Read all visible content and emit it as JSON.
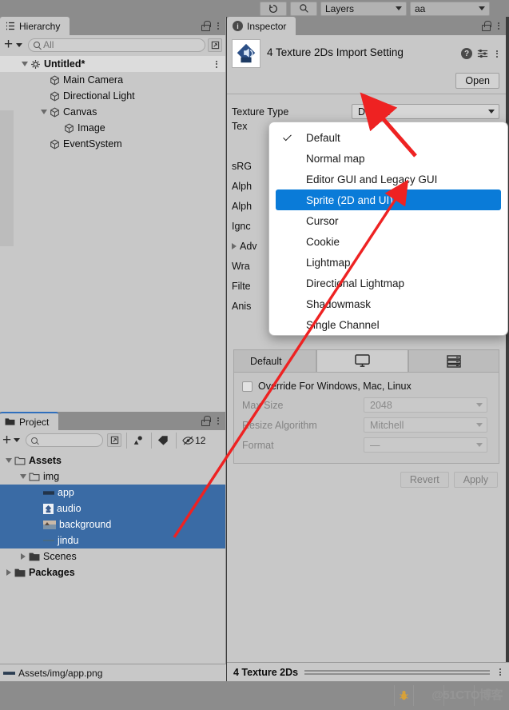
{
  "toolbar": {
    "history_icon": "history-icon",
    "search_icon": "search-icon",
    "layers_label": "Layers",
    "layout_label": "aa"
  },
  "hierarchy": {
    "tab_label": "Hierarchy",
    "create_label": "+",
    "search_value": "",
    "search_placeholder": "All",
    "scene_name": "Untitled*",
    "items": [
      {
        "label": "Main Camera",
        "depth": 2,
        "expandable": false
      },
      {
        "label": "Directional Light",
        "depth": 2,
        "expandable": false
      },
      {
        "label": "Canvas",
        "depth": 2,
        "expandable": true
      },
      {
        "label": "Image",
        "depth": 3,
        "expandable": false
      },
      {
        "label": "EventSystem",
        "depth": 2,
        "expandable": false
      }
    ]
  },
  "project": {
    "tab_label": "Project",
    "create_label": "+",
    "search_value": "",
    "search_placeholder": "",
    "hidden_count": "12",
    "items": [
      {
        "label": "Assets",
        "depth": 0,
        "type": "folder",
        "expanded": true,
        "selected": false,
        "bold": true
      },
      {
        "label": "img",
        "depth": 1,
        "type": "folder",
        "expanded": true,
        "selected": false,
        "bold": false
      },
      {
        "label": "app",
        "depth": 2,
        "type": "texture",
        "expanded": null,
        "selected": true,
        "bold": false
      },
      {
        "label": "audio",
        "depth": 2,
        "type": "texture",
        "expanded": null,
        "selected": true,
        "bold": false
      },
      {
        "label": "background",
        "depth": 2,
        "type": "texture",
        "expanded": null,
        "selected": true,
        "bold": false
      },
      {
        "label": "jindu",
        "depth": 2,
        "type": "texture",
        "expanded": null,
        "selected": true,
        "bold": false
      },
      {
        "label": "Scenes",
        "depth": 1,
        "type": "folder",
        "expanded": false,
        "selected": false,
        "bold": false
      },
      {
        "label": "Packages",
        "depth": 0,
        "type": "folder",
        "expanded": false,
        "selected": false,
        "bold": true
      }
    ],
    "status_path": "Assets/img/app.png"
  },
  "inspector": {
    "tab_label": "Inspector",
    "title": "4 Texture 2Ds Import Setting",
    "help_label": "?",
    "open_button": "Open",
    "texture_type_label": "Texture Type",
    "texture_type_value": "Default",
    "obscured_fields": [
      {
        "label": "Tex",
        "dim": false
      },
      {
        "label": "",
        "dim": false
      },
      {
        "label": "sRG",
        "dim": false
      },
      {
        "label": "Alph",
        "dim": false
      },
      {
        "label": "Alph",
        "dim": false
      },
      {
        "label": "Ignc",
        "dim": false
      },
      {
        "label": "Adv",
        "dim": false,
        "foldout": true
      },
      {
        "label": "Wra",
        "dim": false
      },
      {
        "label": "Filte",
        "dim": false
      },
      {
        "label": "Anis",
        "dim": false
      }
    ],
    "dropdown": {
      "options": [
        {
          "label": "Default",
          "checked": true,
          "highlighted": false
        },
        {
          "label": "Normal map",
          "checked": false,
          "highlighted": false
        },
        {
          "label": "Editor GUI and Legacy GUI",
          "checked": false,
          "highlighted": false
        },
        {
          "label": "Sprite (2D and UI)",
          "checked": false,
          "highlighted": true
        },
        {
          "label": "Cursor",
          "checked": false,
          "highlighted": false
        },
        {
          "label": "Cookie",
          "checked": false,
          "highlighted": false
        },
        {
          "label": "Lightmap",
          "checked": false,
          "highlighted": false
        },
        {
          "label": "Directional Lightmap",
          "checked": false,
          "highlighted": false
        },
        {
          "label": "Shadowmask",
          "checked": false,
          "highlighted": false
        },
        {
          "label": "Single Channel",
          "checked": false,
          "highlighted": false
        }
      ]
    },
    "platform": {
      "tabs": [
        {
          "label": "Default",
          "icon": null,
          "active": false
        },
        {
          "label": "",
          "icon": "desktop-icon",
          "active": true
        },
        {
          "label": "",
          "icon": "server-icon",
          "active": false
        }
      ],
      "override_label": "Override For Windows, Mac, Linux",
      "override_checked": false,
      "rows": [
        {
          "label": "Max Size",
          "value": "2048"
        },
        {
          "label": "Resize Algorithm",
          "value": "Mitchell"
        },
        {
          "label": "Format",
          "value": "—"
        }
      ],
      "revert_button": "Revert",
      "apply_button": "Apply"
    },
    "status_label": "4 Texture 2Ds"
  },
  "watermark": {
    "text": "@51CTO博客",
    "bug_icon": "bug-icon"
  },
  "colors": {
    "panel_bg": "#c8c8c8",
    "chrome_bg": "#8c8c8c",
    "selection_blue": "#3a6ba5",
    "menu_highlight_blue": "#0a7bd8",
    "annotation_red": "#ee2222"
  }
}
